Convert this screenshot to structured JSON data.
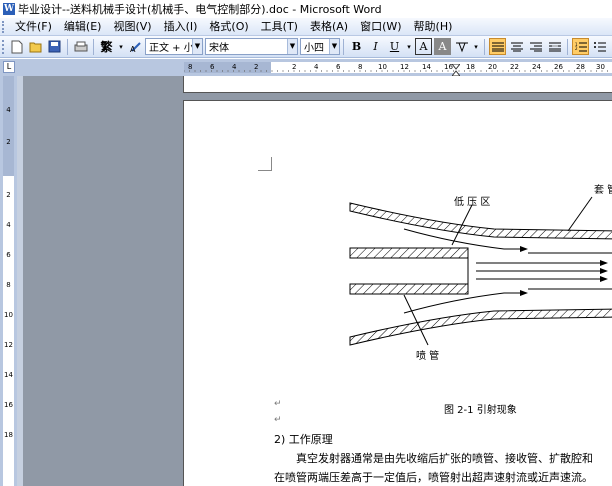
{
  "window": {
    "title": "毕业设计--送料机械手设计(机械手、电气控制部分).doc - Microsoft Word",
    "app_icon": "W"
  },
  "menu": {
    "items": [
      {
        "label": "文件(F)"
      },
      {
        "label": "编辑(E)"
      },
      {
        "label": "视图(V)"
      },
      {
        "label": "插入(I)"
      },
      {
        "label": "格式(O)"
      },
      {
        "label": "工具(T)"
      },
      {
        "label": "表格(A)"
      },
      {
        "label": "窗口(W)"
      },
      {
        "label": "帮助(H)"
      }
    ]
  },
  "toolbar": {
    "trad_chinese_label": "繁",
    "style_value": "正文 + 小四",
    "font_value": "宋体",
    "size_value": "小四",
    "bold_label": "B",
    "italic_label": "I",
    "underline_label": "U",
    "char_border_label": "A",
    "char_shade_label": "A",
    "accent_color": "#ffcc66"
  },
  "ruler": {
    "tab_selector": "L",
    "h_numbers": [
      "8",
      "6",
      "4",
      "2",
      "2",
      "4",
      "6",
      "8",
      "10",
      "12",
      "14",
      "16",
      "18",
      "20",
      "22",
      "24",
      "26",
      "28",
      "30",
      "32"
    ],
    "v_numbers": [
      "4",
      "2",
      "2",
      "4",
      "6",
      "8",
      "10",
      "12",
      "14",
      "16",
      "18"
    ]
  },
  "document": {
    "figure_labels": {
      "low_pressure": "低 压 区",
      "sleeve": "套 管",
      "nozzle": "喷 管"
    },
    "caption": "图 2-1    引射现象",
    "section_heading": "2) 工作原理",
    "body_line1": "真空发射器通常是由先收缩后扩张的喷管、接收管、扩散腔和",
    "body_line2": "在喷管两端压差高于一定值后，喷管射出超声速射流或近声速流。",
    "paragraph_mark": "↵"
  }
}
